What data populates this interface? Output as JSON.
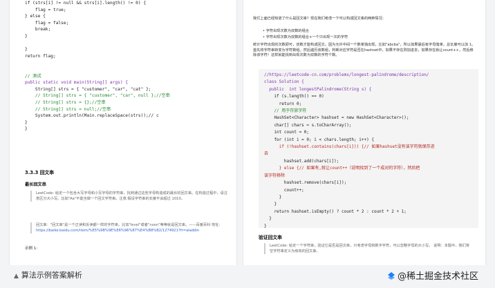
{
  "left_page": {
    "code_lines": [
      [
        "if (strs[i] != null && strs[i].length() != 0) {",
        "plain"
      ],
      [
        "    flag = true;",
        "plain"
      ],
      [
        "} else {",
        "plain"
      ],
      [
        "    flag = false;",
        "plain"
      ],
      [
        "    break;",
        "plain"
      ],
      [
        "}",
        "plain"
      ],
      [
        "",
        "plain"
      ],
      [
        "}",
        "plain"
      ],
      [
        "return flag;",
        "plain"
      ],
      [
        "",
        "plain"
      ],
      [
        "",
        "plain"
      ],
      [
        "// 测试",
        "cm"
      ],
      [
        "public static void main(String[] args) {",
        "kw"
      ],
      [
        "    String[] strs = { \"customer\", \"car\", \"cat\" };",
        "plain"
      ],
      [
        "    // String[] strs = { \"customer\", \"car\", null };//空串",
        "cm"
      ],
      [
        "    // String[] strs = {};//空串",
        "cm"
      ],
      [
        "    // String[] strs = null;//空串",
        "cm"
      ],
      [
        "    System.out.println(Main.replaceSpace(strs));// c",
        "plain"
      ],
      [
        "}",
        "plain"
      ],
      [
        "}",
        "plain"
      ]
    ],
    "section_title": "3.3.3 回文串",
    "sub_title": "最长回文串",
    "quote1": "LeetCode: 给定一个包含大写字母和小写字母的字符串，找到通过这些字母构造成的最长的回文串。在构造过程中，请注意区分大小写。比如\"Aa\"不能当做一个回文字符串。注意:假设字符串的长度不会超过 1010。",
    "quote2_text": "回文串：\"回文串\"是一个正读和反读都一样的字符串，比如\"level\"或者\"noon\"等等就是回文串。——百度百科 地址：",
    "quote2_link": "https://baike.baidu.com/item/%E5%9B%9E%E6%96%87%E4%B8%B2/1274921?fr=aladdin",
    "example": "示例 1:"
  },
  "right_page": {
    "intro": "我们上面已经知道了什么是回文串？现在我们考虑一下可以构成回文串的两种情况：",
    "bullets": [
      "字符出现次数为双数的组合",
      "字符出现次数为双数的组合+一个只出现一次的字符"
    ],
    "para": "统计字符出现的次数即可，双数才能构成回文。因为允许中间一个数单独出现，比如\"abcba\"，所以如果最后有字母落单，总长度可以加 1。首先将字符串转变为字符数组。然后遍历该数组，判断对应字符是否在hashset中，如果不存在则加进去，如果存在就让count++，然后移除该字符！这样就能找到出现次数为双数的字符个数。",
    "code_lines": [
      [
        "//https://leetcode-cn.com/problems/longest-palindrome/description/",
        "kw"
      ],
      [
        "class Solution {",
        "kw"
      ],
      [
        "  public  int longestPalindrome(String s) {",
        "kw"
      ],
      [
        "    if (s.length() == 0)",
        "plain"
      ],
      [
        "      return 0;",
        "plain"
      ],
      [
        "    // 用于存放字符",
        "cm"
      ],
      [
        "    HashSet<Character> hashset = new HashSet<Character>();",
        "plain"
      ],
      [
        "    char[] chars = s.toCharArray();",
        "plain"
      ],
      [
        "    int count = 0;",
        "plain"
      ],
      [
        "    for (int i = 0; i < chars.length; i++) {",
        "plain"
      ],
      [
        "      if (!hashset.contains(chars[i])) {// 如果hashset没有该字符就保存进",
        "st"
      ],
      [
        "去",
        "st"
      ],
      [
        "        hashset.add(chars[i]);",
        "plain"
      ],
      [
        "      } else {// 如果有,就让count++（说明找到了一个成对的字符），然后把",
        "st"
      ],
      [
        "该字符移除",
        "st"
      ],
      [
        "        hashset.remove(chars[i]);",
        "plain"
      ],
      [
        "        count++;",
        "plain"
      ],
      [
        "      }",
        "plain"
      ],
      [
        "    }",
        "plain"
      ],
      [
        "    return hashset.isEmpty() ? count * 2 : count * 2 + 1;",
        "plain"
      ],
      [
        "  }",
        "plain"
      ],
      [
        "}",
        "plain"
      ]
    ],
    "section_title": "验证回文串",
    "quote": "LeetCode: 给定一个字符串，验证它是否是回文串，只考虑字母和数字字符，可以忽略字母的大小写。 说明：本题中，我们将空字符串定义为有效的回文串。"
  },
  "footer": {
    "left_label": "算法示例答案解析",
    "watermark": "@稀土掘金技术社区"
  }
}
